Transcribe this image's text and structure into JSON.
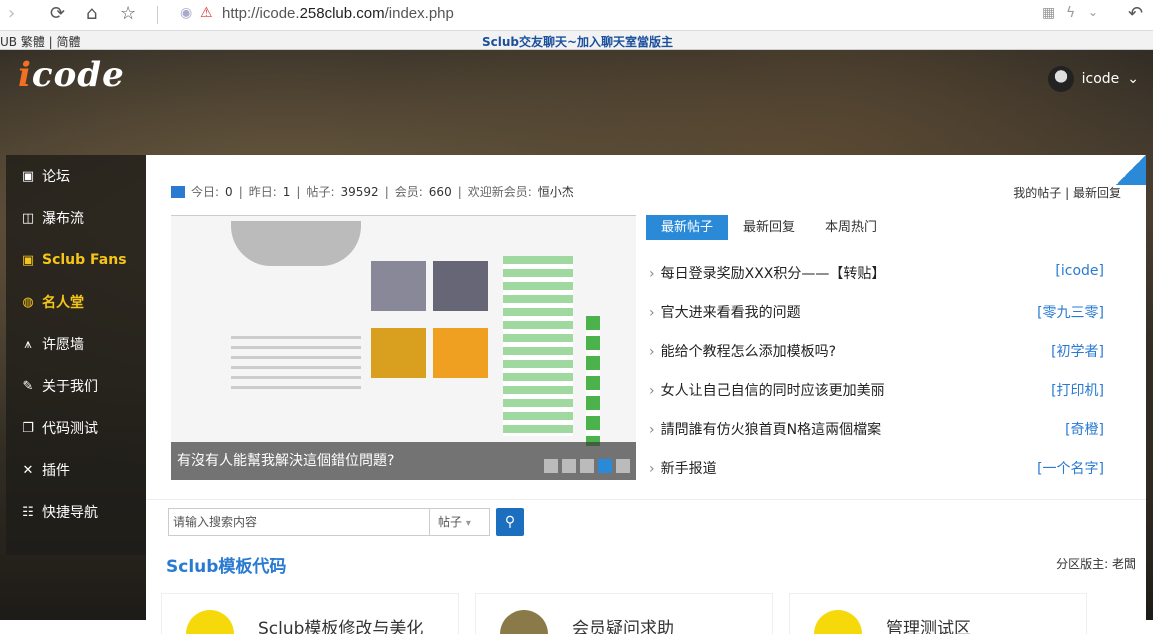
{
  "browser": {
    "url_prefix": "http://icode.",
    "url_host": "258club.com",
    "url_path": "/index.php"
  },
  "notice": {
    "left": "UB 繁體 | 简體",
    "center": "Sclub交友聊天~加入聊天室當版主"
  },
  "header": {
    "logo_i": "i",
    "logo_rest": "code",
    "username": "icode"
  },
  "sidebar": {
    "items": [
      {
        "label": "论坛",
        "icon": "forum-icon"
      },
      {
        "label": "瀑布流",
        "icon": "camera-icon"
      },
      {
        "label": "Sclub Fans",
        "icon": "chat-icon"
      },
      {
        "label": "名人堂",
        "icon": "chat-bubble-icon"
      },
      {
        "label": "许愿墙",
        "icon": "wish-icon"
      },
      {
        "label": "关于我们",
        "icon": "edit-icon"
      },
      {
        "label": "代码测试",
        "icon": "window-icon"
      },
      {
        "label": "插件",
        "icon": "tools-icon"
      },
      {
        "label": "快捷导航",
        "icon": "grid-icon"
      }
    ]
  },
  "stats": {
    "today_label": "今日:",
    "today": "0",
    "yesterday_label": "昨日:",
    "yesterday": "1",
    "posts_label": "帖子:",
    "posts": "39592",
    "members_label": "会员:",
    "members": "660",
    "newmember_label": "欢迎新会员:",
    "newmember": "恒小杰"
  },
  "toplinks": {
    "my_posts": "我的帖子",
    "latest_reply": "最新回复"
  },
  "slide": {
    "caption": "有沒有人能幫我解決這個錯位問題?"
  },
  "tabs": [
    {
      "label": "最新帖子",
      "active": true
    },
    {
      "label": "最新回复",
      "active": false
    },
    {
      "label": "本周热门",
      "active": false
    }
  ],
  "posts": [
    {
      "title": "每日登录奖励XXX积分——【转贴】",
      "author": "[icode]"
    },
    {
      "title": "官大进来看看我的问题",
      "author": "[零九三零]"
    },
    {
      "title": "能给个教程怎么添加模板吗?",
      "author": "[初学者]"
    },
    {
      "title": "女人让自己自信的同时应该更加美丽",
      "author": "[打印机]"
    },
    {
      "title": "請問誰有仿火狼首頁N格這兩個檔案",
      "author": "[奇橙]"
    },
    {
      "title": "新手报道",
      "author": "[一个名字]"
    }
  ],
  "search": {
    "placeholder": "请输入搜索内容",
    "type": "帖子"
  },
  "section": {
    "title": "Sclub模板代码",
    "moderator": "分区版主: 老闆"
  },
  "cards": [
    {
      "label": "Sclub模板修改与美化"
    },
    {
      "label": "会员疑问求助"
    },
    {
      "label": "管理测试区"
    }
  ]
}
